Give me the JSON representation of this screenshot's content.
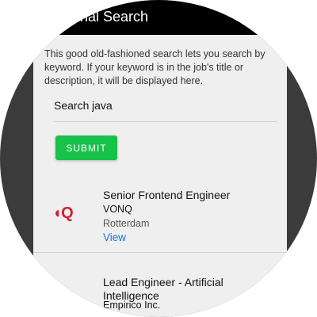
{
  "header": {
    "title": "onal Search"
  },
  "description": "This good old-fashioned search lets you search by keyword. If your keyword is in the job's title or description, it will be displayed here.",
  "search": {
    "label": "Search",
    "value": "java"
  },
  "submit_label": "SUBMIT",
  "jobs": [
    {
      "logo": "◖Q",
      "title": "Senior Frontend Engineer",
      "company": "VONQ",
      "location": "Rotterdam",
      "link": "View"
    },
    {
      "title": "Lead Engineer - Artificial Intelligence",
      "company": "Empirico Inc."
    }
  ],
  "colors": {
    "header_bg": "#000000",
    "submit_bg": "#17c14a",
    "link": "#1a73e8",
    "logo": "#d21f2f"
  }
}
